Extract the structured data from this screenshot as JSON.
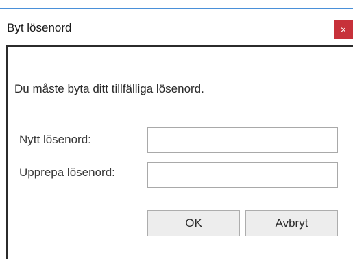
{
  "window": {
    "title": "Byt lösenord",
    "close_glyph": "×",
    "accent_color": "#4a90d9",
    "close_color": "#c7313a"
  },
  "content": {
    "message": "Du måste byta ditt tillfälliga lösenord.",
    "new_password_label": "Nytt lösenord:",
    "new_password_value": "",
    "repeat_password_label": "Upprepa lösenord:",
    "repeat_password_value": ""
  },
  "buttons": {
    "ok_label": "OK",
    "cancel_label": "Avbryt"
  }
}
